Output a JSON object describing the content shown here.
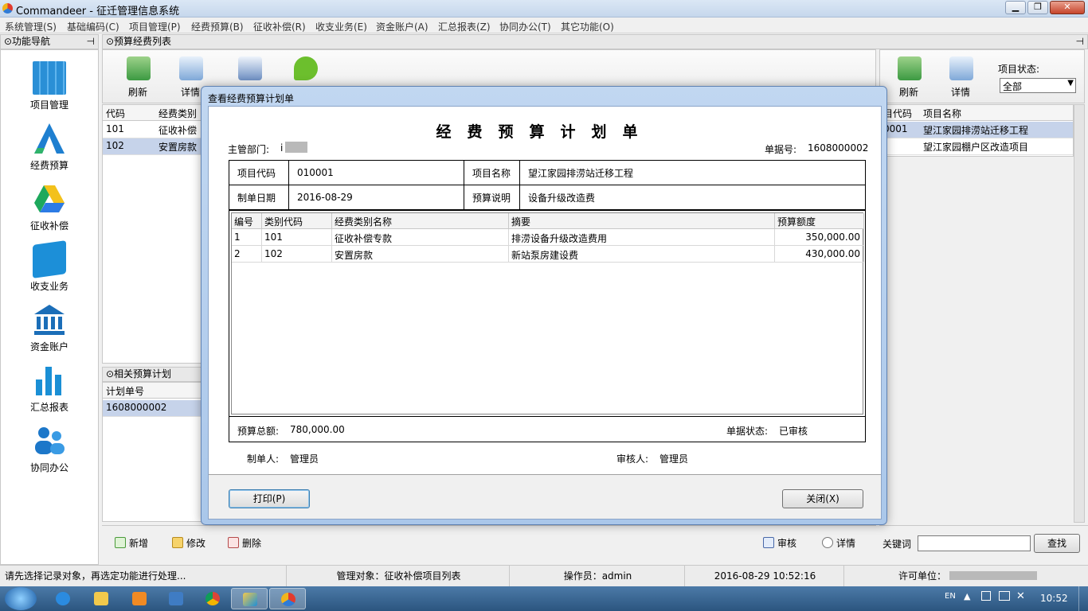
{
  "window": {
    "title": "Commandeer - 征迁管理信息系统"
  },
  "menu": [
    "系统管理(S)",
    "基础编码(C)",
    "项目管理(P)",
    "经费预算(B)",
    "征收补偿(R)",
    "收支业务(E)",
    "资金账户(A)",
    "汇总报表(Z)",
    "协同办公(T)",
    "其它功能(O)"
  ],
  "nav": {
    "header": "⊙功能导航",
    "items": [
      {
        "label": "项目管理",
        "icon": "building-icon",
        "color": "#2a8fd6"
      },
      {
        "label": "经费预算",
        "icon": "triangle-a-icon",
        "color": "#1e7fd0"
      },
      {
        "label": "征收补偿",
        "icon": "drive-icon",
        "color": "#1da85c"
      },
      {
        "label": "收支业务",
        "icon": "cards-icon",
        "color": "#1c8fd8"
      },
      {
        "label": "资金账户",
        "icon": "bank-icon",
        "color": "#1b6eb8"
      },
      {
        "label": "汇总报表",
        "icon": "bar-chart-icon",
        "color": "#1a8fd5"
      },
      {
        "label": "协同办公",
        "icon": "users-icon",
        "color": "#1c77c9"
      }
    ]
  },
  "budget_list": {
    "header": "⊙预算经费列表",
    "toolbar": {
      "refresh": "刷新",
      "detail": "详情"
    },
    "columns": [
      "代码",
      "经费类别"
    ],
    "rows": [
      {
        "code": "101",
        "name": "征收补偿"
      },
      {
        "code": "102",
        "name": "安置房款"
      }
    ]
  },
  "related_plan": {
    "header": "⊙相关预算计划",
    "column": "计划单号",
    "rows": [
      "1608000002"
    ]
  },
  "right_panel": {
    "toolbar": {
      "refresh": "刷新",
      "detail": "详情"
    },
    "status_label": "项目状态:",
    "status_value": "全部",
    "columns": [
      "目代码",
      "项目名称"
    ],
    "rows": [
      {
        "code": "0001",
        "name": "望江家园排涝站迁移工程"
      },
      {
        "code": "",
        "name": "望江家园棚户区改造项目"
      }
    ]
  },
  "bottom_actions": {
    "add": "新增",
    "edit": "修改",
    "delete": "删除",
    "audit": "审核",
    "detail": "详情",
    "keyword_label": "关键词",
    "search": "查找"
  },
  "dialog": {
    "title": "查看经费预算计划单",
    "doc_title": "经费预算计划单",
    "dept_label": "主管部门:",
    "dept_value": "i",
    "bill_no_label": "单据号:",
    "bill_no": "1608000002",
    "project_code_label": "项目代码",
    "project_code": "010001",
    "project_name_label": "项目名称",
    "project_name": "望江家园排涝站迁移工程",
    "date_label": "制单日期",
    "date": "2016-08-29",
    "desc_label": "预算说明",
    "desc": "设备升级改造费",
    "columns": [
      "编号",
      "类别代码",
      "经费类别名称",
      "摘要",
      "预算额度"
    ],
    "lines": [
      {
        "no": "1",
        "code": "101",
        "name": "征收补偿专款",
        "summary": "排涝设备升级改造费用",
        "amount": "350,000.00"
      },
      {
        "no": "2",
        "code": "102",
        "name": "安置房款",
        "summary": "新站泵房建设费",
        "amount": "430,000.00"
      }
    ],
    "total_label": "预算总额:",
    "total": "780,000.00",
    "bill_status_label": "单据状态:",
    "bill_status": "已审核",
    "maker_label": "制单人:",
    "maker": "管理员",
    "auditor_label": "审核人:",
    "auditor": "管理员",
    "print_button": "打印(P)",
    "close_button": "关闭(X)"
  },
  "status_bar": {
    "hint": "请先选择记录对象，再选定功能进行处理...",
    "object": "管理对象：征收补偿项目列表",
    "operator": "操作员：admin",
    "datetime": "2016-08-29 10:52:16",
    "license": "许可单位："
  },
  "taskbar": {
    "lang": "EN",
    "clock": "10:52"
  }
}
